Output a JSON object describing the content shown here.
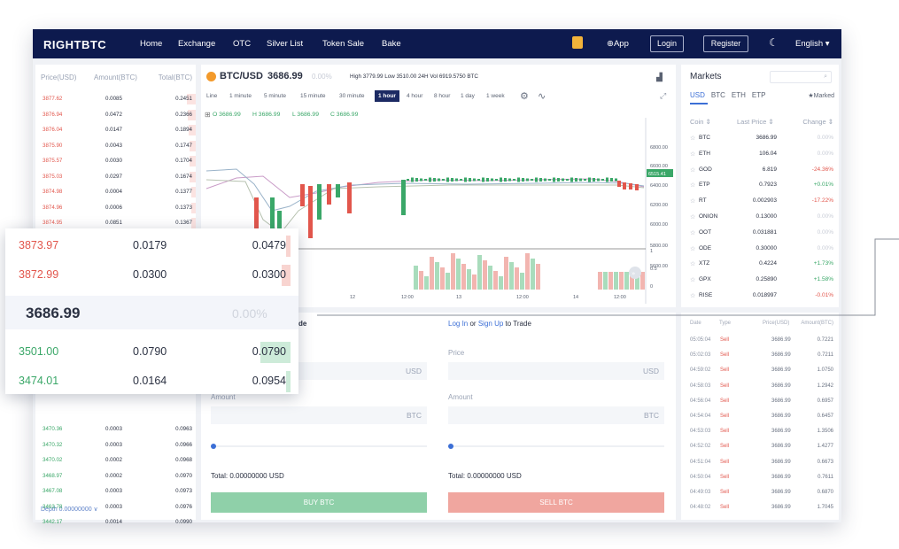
{
  "nav": {
    "logo": "RIGHTBTC",
    "links": [
      "Home",
      "Exchange",
      "OTC",
      "Silver List",
      "Token Sale",
      "Bake"
    ],
    "app": "App",
    "login": "Login",
    "register": "Register",
    "language": "English ▾",
    "moon_icon": "moon-icon",
    "gift_icon": "gift-icon"
  },
  "orderbook": {
    "headers": [
      "Price(USD)",
      "Amount(BTC)",
      "Total(BTC)"
    ],
    "asks": [
      [
        "3877.62",
        "0.0085",
        "0.2451"
      ],
      [
        "3876.94",
        "0.0472",
        "0.2366"
      ],
      [
        "3876.04",
        "0.0147",
        "0.1894"
      ],
      [
        "3875.90",
        "0.0043",
        "0.1747"
      ],
      [
        "3875.57",
        "0.0030",
        "0.1704"
      ],
      [
        "3875.03",
        "0.0297",
        "0.1674"
      ],
      [
        "3874.98",
        "0.0004",
        "0.1377"
      ],
      [
        "3874.96",
        "0.0006",
        "0.1373"
      ],
      [
        "3874.95",
        "0.0851",
        "0.1367"
      ]
    ],
    "bids": [
      [
        "3470.36",
        "0.0003",
        "0.0963"
      ],
      [
        "3470.32",
        "0.0003",
        "0.0966"
      ],
      [
        "3470.02",
        "0.0002",
        "0.0968"
      ],
      [
        "3468.97",
        "0.0002",
        "0.0970"
      ],
      [
        "3467.08",
        "0.0003",
        "0.0973"
      ],
      [
        "3463.78",
        "0.0003",
        "0.0976"
      ],
      [
        "3442.17",
        "0.0014",
        "0.0990"
      ]
    ],
    "depth": "Depth 0.00000000 ∨"
  },
  "ticker": {
    "pair": "BTC/USD",
    "price": "3686.99",
    "change": "0.00%",
    "stats": "High 3779.99 Low 3510.00 24H Vol 6919.5750 BTC",
    "ohlc": [
      "O 3686.99",
      "H 3686.99",
      "L 3686.99",
      "C 3686.99"
    ]
  },
  "chart": {
    "timeframes": [
      "Line",
      "1 minute",
      "5 minute",
      "15 minute",
      "30 minute",
      "1 hour",
      "4 hour",
      "8 hour",
      "1 day",
      "1 week"
    ],
    "active_timeframe": "1 hour",
    "price_ticks": [
      "6800.00",
      "6600.00",
      "6400.00",
      "6200.00",
      "6000.00",
      "5800.00",
      "5600.00"
    ],
    "current_price_tag": "6515.41",
    "vol_ticks": [
      "1",
      "0.5",
      "0"
    ],
    "time_ticks": [
      "12",
      "12:00",
      "13",
      "12:00",
      "14",
      "12:00"
    ]
  },
  "trade": {
    "buy_title_tail": "de",
    "login_text": [
      "Log In",
      "or",
      "Sign Up",
      "to Trade"
    ],
    "price_label": "Price",
    "amount_label": "Amount",
    "usd": "USD",
    "btc": "BTC",
    "total": "Total: 0.00000000 USD",
    "buy_btn": "BUY BTC",
    "sell_btn": "SELL BTC"
  },
  "markets": {
    "title": "Markets",
    "tabs": [
      "USD",
      "BTC",
      "ETH",
      "ETP"
    ],
    "marked": "★Marked",
    "headers": [
      "Coin ⇕",
      "Last Price ⇕",
      "Change ⇕"
    ],
    "rows": [
      [
        "BTC",
        "3686.99",
        "0.00%"
      ],
      [
        "ETH",
        "106.04",
        "0.00%"
      ],
      [
        "GOD",
        "6.819",
        "-24.36%"
      ],
      [
        "ETP",
        "0.7923",
        "+0.01%"
      ],
      [
        "RT",
        "0.002903",
        "-17.22%"
      ],
      [
        "ONION",
        "0.13000",
        "0.00%"
      ],
      [
        "OOT",
        "0.031881",
        "0.00%"
      ],
      [
        "ODE",
        "0.30000",
        "0.00%"
      ],
      [
        "XTZ",
        "0.4224",
        "+1.73%"
      ],
      [
        "GPX",
        "0.25890",
        "+1.58%"
      ],
      [
        "RISE",
        "0.018997",
        "-0.01%"
      ]
    ]
  },
  "trades": {
    "headers": [
      "Date",
      "Type",
      "Price(USD)",
      "Amount(BTC)"
    ],
    "rows": [
      [
        "05:05:04",
        "Sell",
        "3686.99",
        "0.7221"
      ],
      [
        "05:02:03",
        "Sell",
        "3686.99",
        "0.7211"
      ],
      [
        "04:59:02",
        "Sell",
        "3686.99",
        "1.0750"
      ],
      [
        "04:58:03",
        "Sell",
        "3686.99",
        "1.2942"
      ],
      [
        "04:56:04",
        "Sell",
        "3686.99",
        "0.6957"
      ],
      [
        "04:54:04",
        "Sell",
        "3686.99",
        "0.6457"
      ],
      [
        "04:53:03",
        "Sell",
        "3686.99",
        "1.3506"
      ],
      [
        "04:52:02",
        "Sell",
        "3686.99",
        "1.4277"
      ],
      [
        "04:51:04",
        "Sell",
        "3686.99",
        "0.6673"
      ],
      [
        "04:50:04",
        "Sell",
        "3686.99",
        "0.7611"
      ],
      [
        "04:49:03",
        "Sell",
        "3686.99",
        "0.6870"
      ],
      [
        "04:48:02",
        "Sell",
        "3686.99",
        "1.7045"
      ]
    ]
  },
  "zoom": {
    "asks": [
      [
        "3873.97",
        "0.0179",
        "0.0479"
      ],
      [
        "3872.99",
        "0.0300",
        "0.0300"
      ]
    ],
    "mid_price": "3686.99",
    "mid_change": "0.00%",
    "bids": [
      [
        "3501.00",
        "0.0790",
        "0.0790"
      ],
      [
        "3474.01",
        "0.0164",
        "0.0954"
      ]
    ]
  }
}
